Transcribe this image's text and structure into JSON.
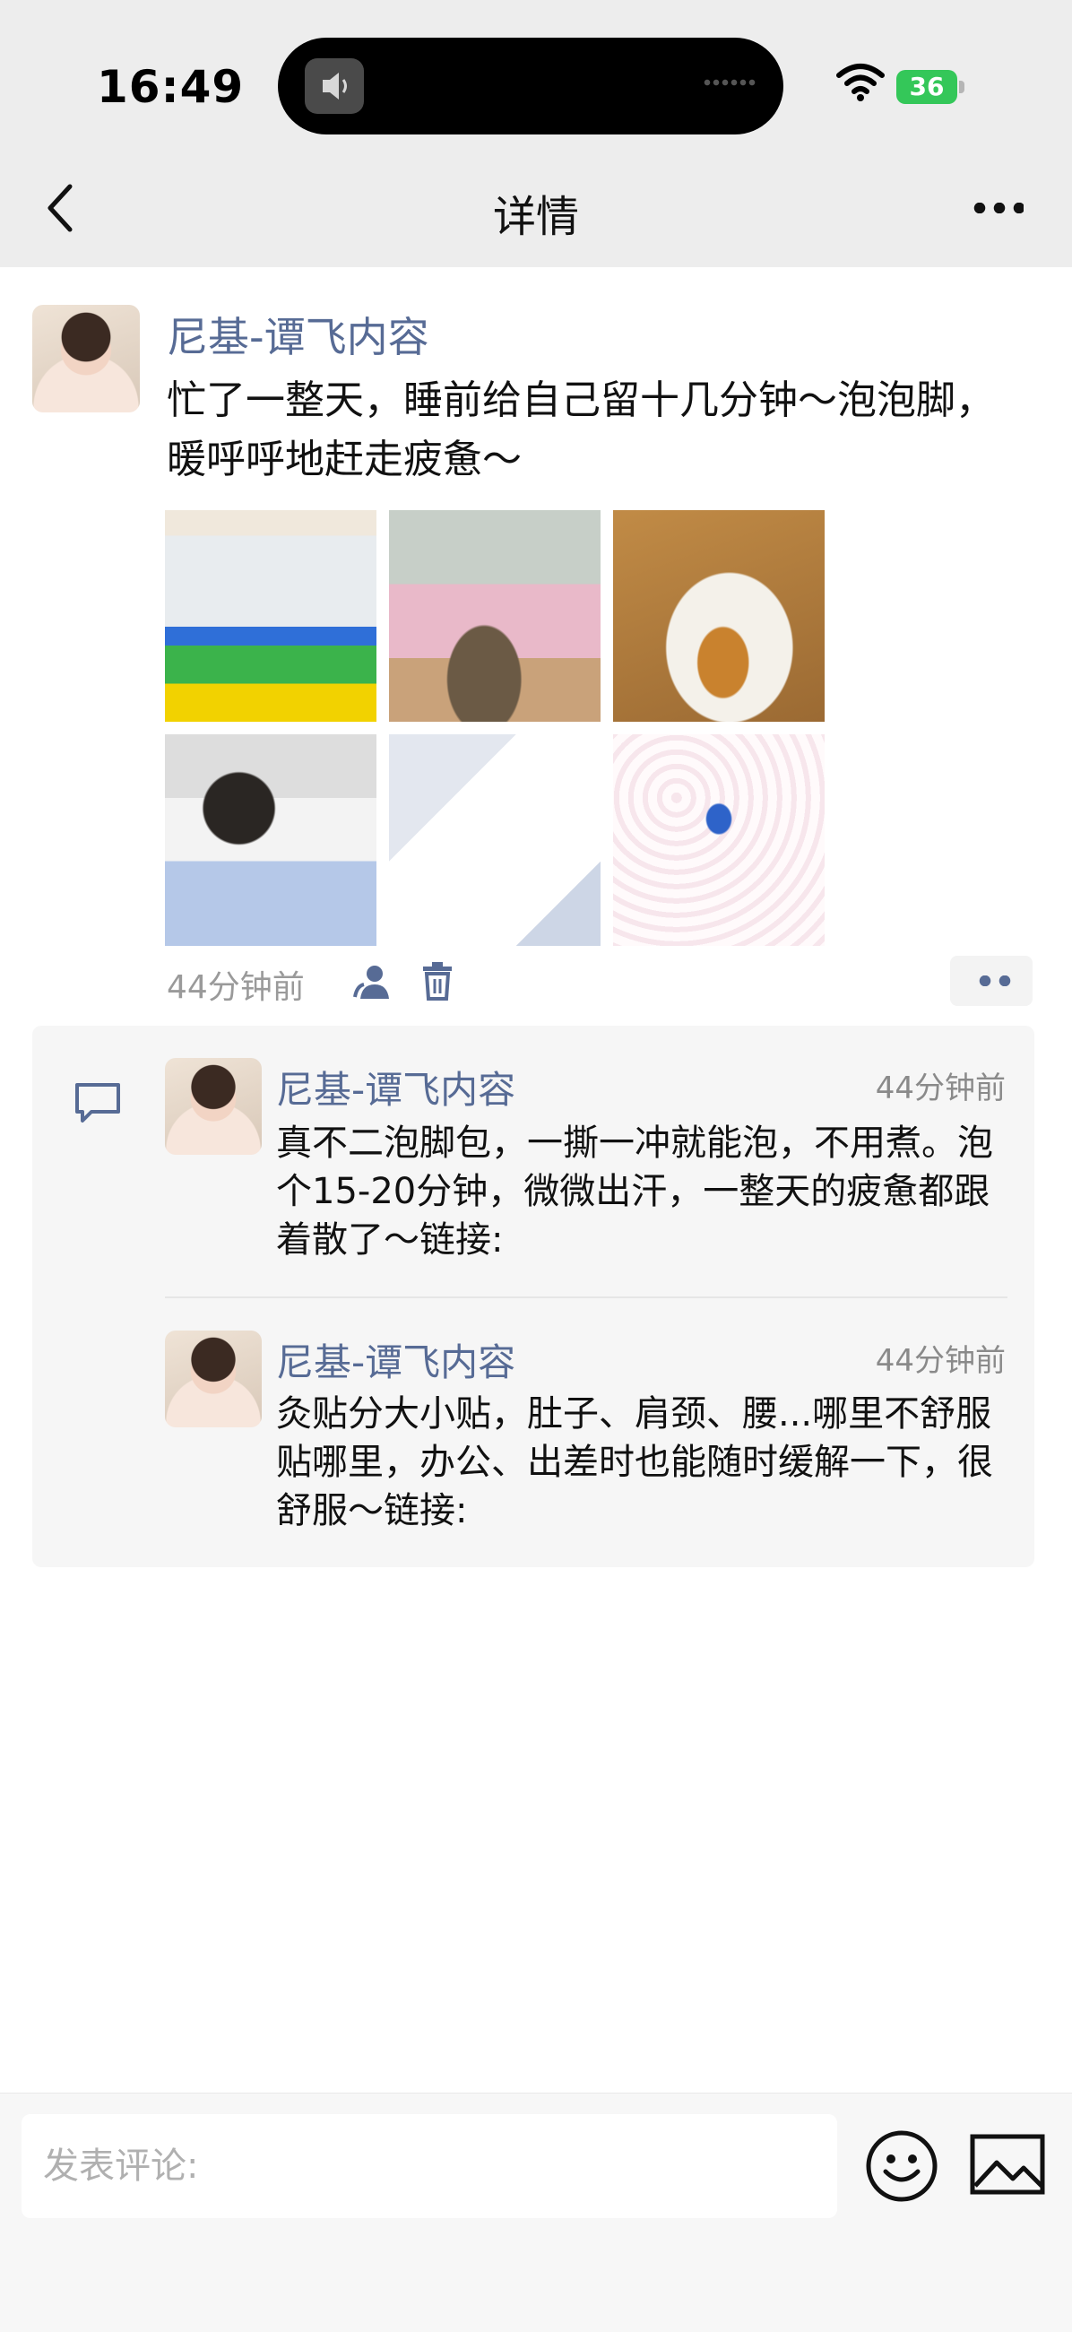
{
  "status_bar": {
    "time": "16:49",
    "battery": "36"
  },
  "nav": {
    "title": "详情"
  },
  "post": {
    "author": "尼基-谭飞内容",
    "text": "忙了一整天，睡前给自己留十几分钟～泡泡脚，暖呼呼地赶走疲惫～",
    "photos": [
      "foot-soak-packs-photo",
      "foot-soak-photo",
      "pouring-herbs-photo",
      "office-laptop-photo",
      "hi-rose-patch-photo",
      "pajamas-patch-photo"
    ],
    "time": "44分钟前"
  },
  "comments": [
    {
      "author": "尼基-谭飞内容",
      "time": "44分钟前",
      "text": "真不二泡脚包，一撕一冲就能泡，不用煮。泡个15-20分钟，微微出汗，一整天的疲惫都跟着散了～链接:"
    },
    {
      "author": "尼基-谭飞内容",
      "time": "44分钟前",
      "text": "灸贴分大小贴，肚子、肩颈、腰...哪里不舒服贴哪里，办公、出差时也能随时缓解一下，很舒服～链接:"
    }
  ],
  "composer": {
    "placeholder": "发表评论:"
  },
  "colors": {
    "link_name": "#576b95",
    "battery": "#34c759",
    "header_bg": "#ededed"
  },
  "icons": [
    "back-arrow-icon",
    "more-icon",
    "friends-icon",
    "trash-icon",
    "comment-icon",
    "emoji-icon",
    "image-icon",
    "wifi-icon",
    "speaker-icon"
  ]
}
